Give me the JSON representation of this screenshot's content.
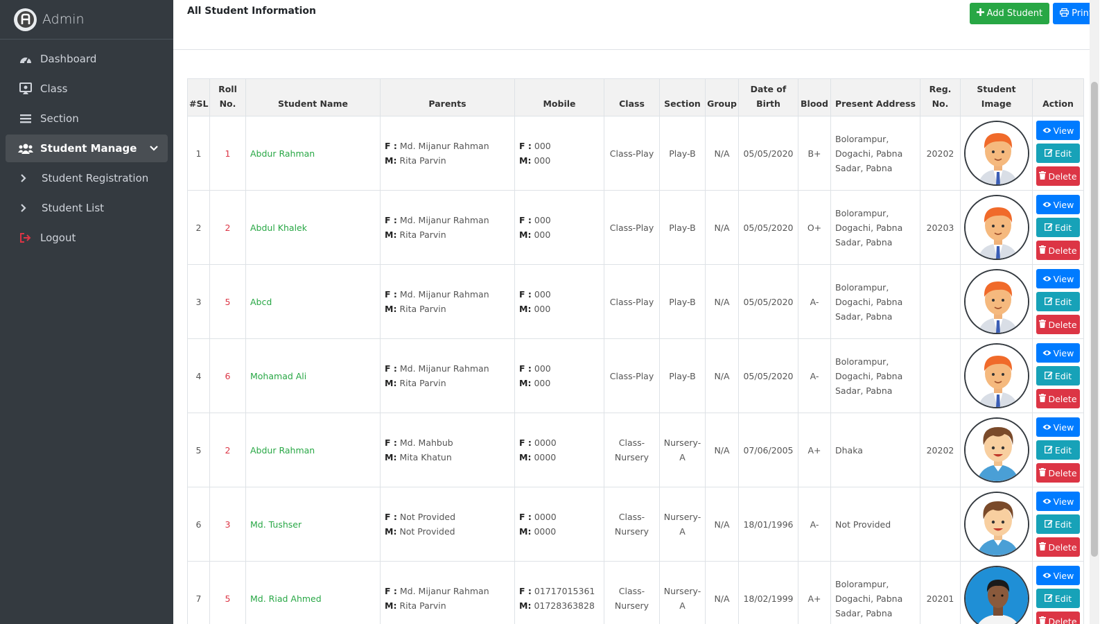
{
  "brand": {
    "name": "Admin"
  },
  "sidebar": {
    "items": [
      {
        "label": "Dashboard",
        "icon": "tachometer-icon"
      },
      {
        "label": "Class",
        "icon": "chalkboard-icon"
      },
      {
        "label": "Section",
        "icon": "bars-icon"
      },
      {
        "label": "Student Manage",
        "icon": "users-icon",
        "active": true
      },
      {
        "label": "Student Registration",
        "icon": "chevron-right-icon"
      },
      {
        "label": "Student List",
        "icon": "chevron-right-icon"
      },
      {
        "label": "Logout",
        "icon": "sign-out-icon"
      }
    ]
  },
  "page": {
    "title": "All Student Information",
    "add_label": "Add Student",
    "print_label": "Print"
  },
  "colors": {
    "sidebar": "#343a40",
    "green": "#28a745",
    "blue": "#007bff",
    "teal": "#17a2b8",
    "red": "#dc3545"
  },
  "table": {
    "headers": {
      "sl": "#SL",
      "roll_1": "Roll",
      "roll_2": "No.",
      "name": "Student Name",
      "parents": "Parents",
      "mobile": "Mobile",
      "class": "Class",
      "section": "Section",
      "group": "Group",
      "dob_1": "Date of",
      "dob_2": "Birth",
      "blood": "Blood",
      "address": "Present Address",
      "reg_1": "Reg.",
      "reg_2": "No.",
      "image": "Student Image",
      "action": "Action"
    },
    "father_label": "F :",
    "mother_label": "M:",
    "view_label": "View",
    "edit_label": "Edit",
    "delete_label": "Delete",
    "rows": [
      {
        "sl": "1",
        "roll": "1",
        "name": "Abdur Rahman",
        "father": "Md. Mijanur Rahman",
        "mother": "Rita Parvin",
        "f_mobile": "000",
        "m_mobile": "000",
        "class": "Class-Play",
        "section": "Play-B",
        "group": "N/A",
        "dob": "05/05/2020",
        "blood": "B+",
        "address": "Bolorampur, Dogachi, Pabna Sadar, Pabna",
        "reg": "20202",
        "avatar": "cartoon-boy-orange"
      },
      {
        "sl": "2",
        "roll": "2",
        "name": "Abdul Khalek",
        "father": "Md. Mijanur Rahman",
        "mother": "Rita Parvin",
        "f_mobile": "000",
        "m_mobile": "000",
        "class": "Class-Play",
        "section": "Play-B",
        "group": "N/A",
        "dob": "05/05/2020",
        "blood": "O+",
        "address": "Bolorampur, Dogachi, Pabna Sadar, Pabna",
        "reg": "20203",
        "avatar": "cartoon-boy-orange"
      },
      {
        "sl": "3",
        "roll": "5",
        "name": "Abcd",
        "father": "Md. Mijanur Rahman",
        "mother": "Rita Parvin",
        "f_mobile": "000",
        "m_mobile": "000",
        "class": "Class-Play",
        "section": "Play-B",
        "group": "N/A",
        "dob": "05/05/2020",
        "blood": "A-",
        "address": "Bolorampur, Dogachi, Pabna Sadar, Pabna",
        "reg": "",
        "avatar": "cartoon-boy-orange"
      },
      {
        "sl": "4",
        "roll": "6",
        "name": "Mohamad Ali",
        "father": "Md. Mijanur Rahman",
        "mother": "Rita Parvin",
        "f_mobile": "000",
        "m_mobile": "000",
        "class": "Class-Play",
        "section": "Play-B",
        "group": "N/A",
        "dob": "05/05/2020",
        "blood": "A-",
        "address": "Bolorampur, Dogachi, Pabna Sadar, Pabna",
        "reg": "",
        "avatar": "cartoon-boy-orange"
      },
      {
        "sl": "5",
        "roll": "2",
        "name": "Abdur Rahman",
        "father": "Md. Mahbub",
        "mother": "Mita Khatun",
        "f_mobile": "0000",
        "m_mobile": "0000",
        "class": "Class-Nursery",
        "section": "Nursery-A",
        "group": "N/A",
        "dob": "07/06/2005",
        "blood": "A+",
        "address": "Dhaka",
        "reg": "20202",
        "avatar": "cartoon-boy-brown"
      },
      {
        "sl": "6",
        "roll": "3",
        "name": "Md. Tushser",
        "father": "Not Provided",
        "mother": "Not Provided",
        "f_mobile": "0000",
        "m_mobile": "0000",
        "class": "Class-Nursery",
        "section": "Nursery-A",
        "group": "N/A",
        "dob": "18/01/1996",
        "blood": "A-",
        "address": "Not Provided",
        "reg": "",
        "avatar": "cartoon-boy-brown"
      },
      {
        "sl": "7",
        "roll": "5",
        "name": "Md. Riad Ahmed",
        "father": "Md. Mijanur Rahman",
        "mother": "Rita Parvin",
        "f_mobile": "01717015361",
        "m_mobile": "01728363828",
        "class": "Class-Nursery",
        "section": "Nursery-A",
        "group": "N/A",
        "dob": "18/02/1999",
        "blood": "A+",
        "address": "Bolorampur, Dogachi, Pabna Sadar, Pabna",
        "reg": "20201",
        "avatar": "photo-blue-bg"
      }
    ]
  }
}
